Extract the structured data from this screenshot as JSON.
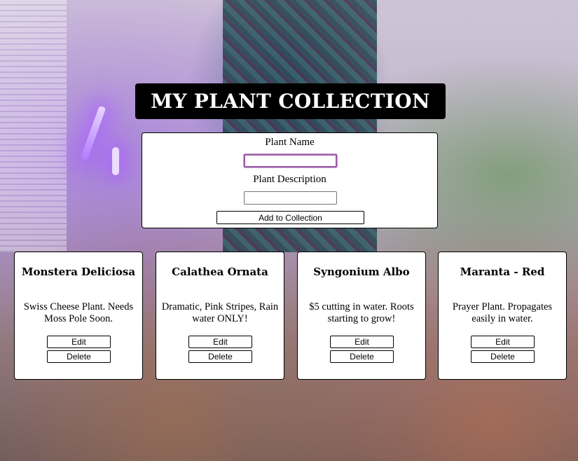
{
  "page": {
    "title": "MY PLANT COLLECTION"
  },
  "form": {
    "name_label": "Plant Name",
    "name_value": "",
    "description_label": "Plant Description",
    "description_value": "",
    "add_button_label": "Add to Collection"
  },
  "plants": [
    {
      "name": "Monstera Deliciosa",
      "description": "Swiss Cheese Plant. Needs Moss Pole Soon.",
      "edit_label": "Edit",
      "delete_label": "Delete"
    },
    {
      "name": "Calathea Ornata",
      "description": "Dramatic, Pink Stripes, Rain water ONLY!",
      "edit_label": "Edit",
      "delete_label": "Delete"
    },
    {
      "name": "Syngonium Albo",
      "description": "$5 cutting in water. Roots starting to grow!",
      "edit_label": "Edit",
      "delete_label": "Delete"
    },
    {
      "name": "Maranta - Red",
      "description": "Prayer Plant. Propagates easily in water.",
      "edit_label": "Edit",
      "delete_label": "Delete"
    }
  ],
  "colors": {
    "title_bar_bg": "#000000",
    "title_text": "#ffffff",
    "card_bg": "#ffffff",
    "focus_ring": "#9b5aa6"
  }
}
